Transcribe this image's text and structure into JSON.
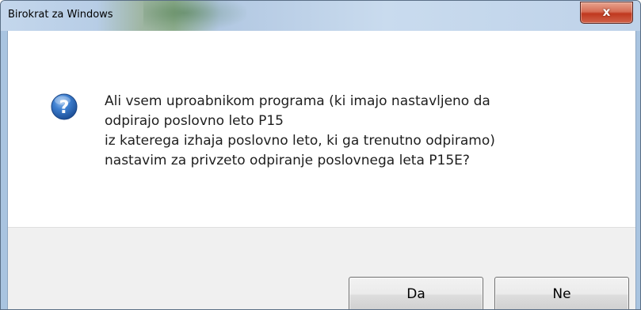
{
  "window": {
    "title": "Birokrat za Windows",
    "close_glyph": "x"
  },
  "dialog": {
    "icon": "question-icon",
    "message_lines": [
      "Ali vsem uproabnikom programa (ki imajo nastavljeno da",
      "odpirajo poslovno leto P15",
      "iz katerega izhaja poslovno leto, ki ga trenutno odpiramo)",
      "nastavim za privzeto odpiranje poslovnega leta P15E?"
    ]
  },
  "buttons": {
    "yes_label": "Da",
    "no_label": "Ne"
  },
  "colors": {
    "title_bar": "#bcd3ea",
    "close_button": "#c0391f",
    "icon_blue": "#2f6fc0",
    "button_bar": "#f0f0f0"
  }
}
